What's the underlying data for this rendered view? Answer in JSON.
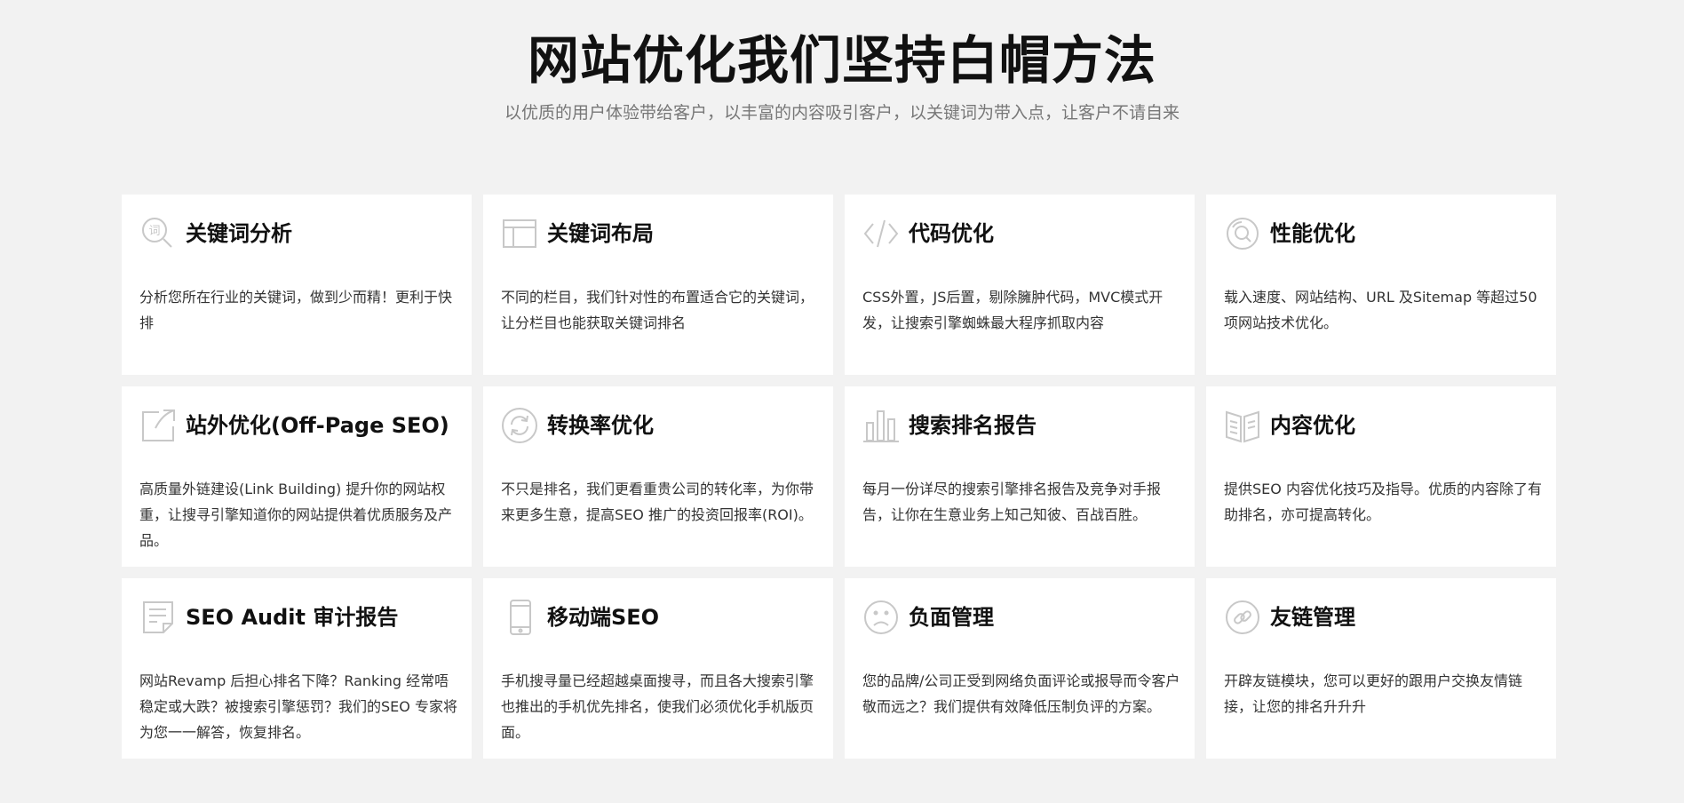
{
  "header": {
    "title": "网站优化我们坚持白帽方法",
    "subtitle": "以优质的用户体验带给客户，以丰富的内容吸引客户，以关键词为带入点，让客户不请自来"
  },
  "colors": {
    "background": "#f2f2f2",
    "card_background": "#ffffff",
    "icon_gray": "#c8c8c8",
    "title_color": "#111111",
    "text_color": "#333333"
  },
  "cards": [
    {
      "icon": "keyword-search-icon",
      "title": "关键词分析",
      "desc": "分析您所在行业的关键词，做到少而精！更利于快排"
    },
    {
      "icon": "layout-icon",
      "title": "关键词布局",
      "desc": "不同的栏目，我们针对性的布置适合它的关键词，让分栏目也能获取关键词排名"
    },
    {
      "icon": "code-icon",
      "title": "代码优化",
      "desc": "CSS外置，JS后置，剔除臃肿代码，MVC模式开发，让搜索引擎蜘蛛最大程序抓取内容"
    },
    {
      "icon": "performance-icon",
      "title": "性能优化",
      "desc": "载入速度、网站结构、URL 及Sitemap 等超过50项网站技术优化。"
    },
    {
      "icon": "external-link-icon",
      "title": "站外优化(Off-Page SEO)",
      "desc": "高质量外链建设(Link Building) 提升你的网站权重，让搜寻引擎知道你的网站提供着优质服务及产品。"
    },
    {
      "icon": "refresh-icon",
      "title": "转换率优化",
      "desc": "不只是排名，我们更看重贵公司的转化率，为你带来更多生意，提高SEO 推广的投资回报率(ROI)。"
    },
    {
      "icon": "bar-chart-icon",
      "title": "搜索排名报告",
      "desc": "每月一份详尽的搜索引擎排名报告及竞争对手报告，让你在生意业务上知己知彼、百战百胜。"
    },
    {
      "icon": "book-icon",
      "title": "内容优化",
      "desc": "提供SEO 内容优化技巧及指导。优质的内容除了有助排名，亦可提高转化。"
    },
    {
      "icon": "document-icon",
      "title": "SEO Audit 审计报告",
      "desc": "网站Revamp 后担心排名下降？Ranking 经常唔稳定或大跌？被搜索引擎惩罚？我们的SEO 专家将为您一一解答，恢复排名。"
    },
    {
      "icon": "mobile-phone-icon",
      "title": "移动端SEO",
      "desc": "手机搜寻量已经超越桌面搜寻，而且各大搜索引擎也推出的手机优先排名，使我们必须优化手机版页面。"
    },
    {
      "icon": "sad-face-icon",
      "title": "负面管理",
      "desc": "您的品牌/公司正受到网络负面评论或报导而令客户敬而远之？我们提供有效降低压制负评的方案。"
    },
    {
      "icon": "link-icon",
      "title": "友链管理",
      "desc": "开辟友链模块，您可以更好的跟用户交换友情链接，让您的排名升升升"
    }
  ]
}
